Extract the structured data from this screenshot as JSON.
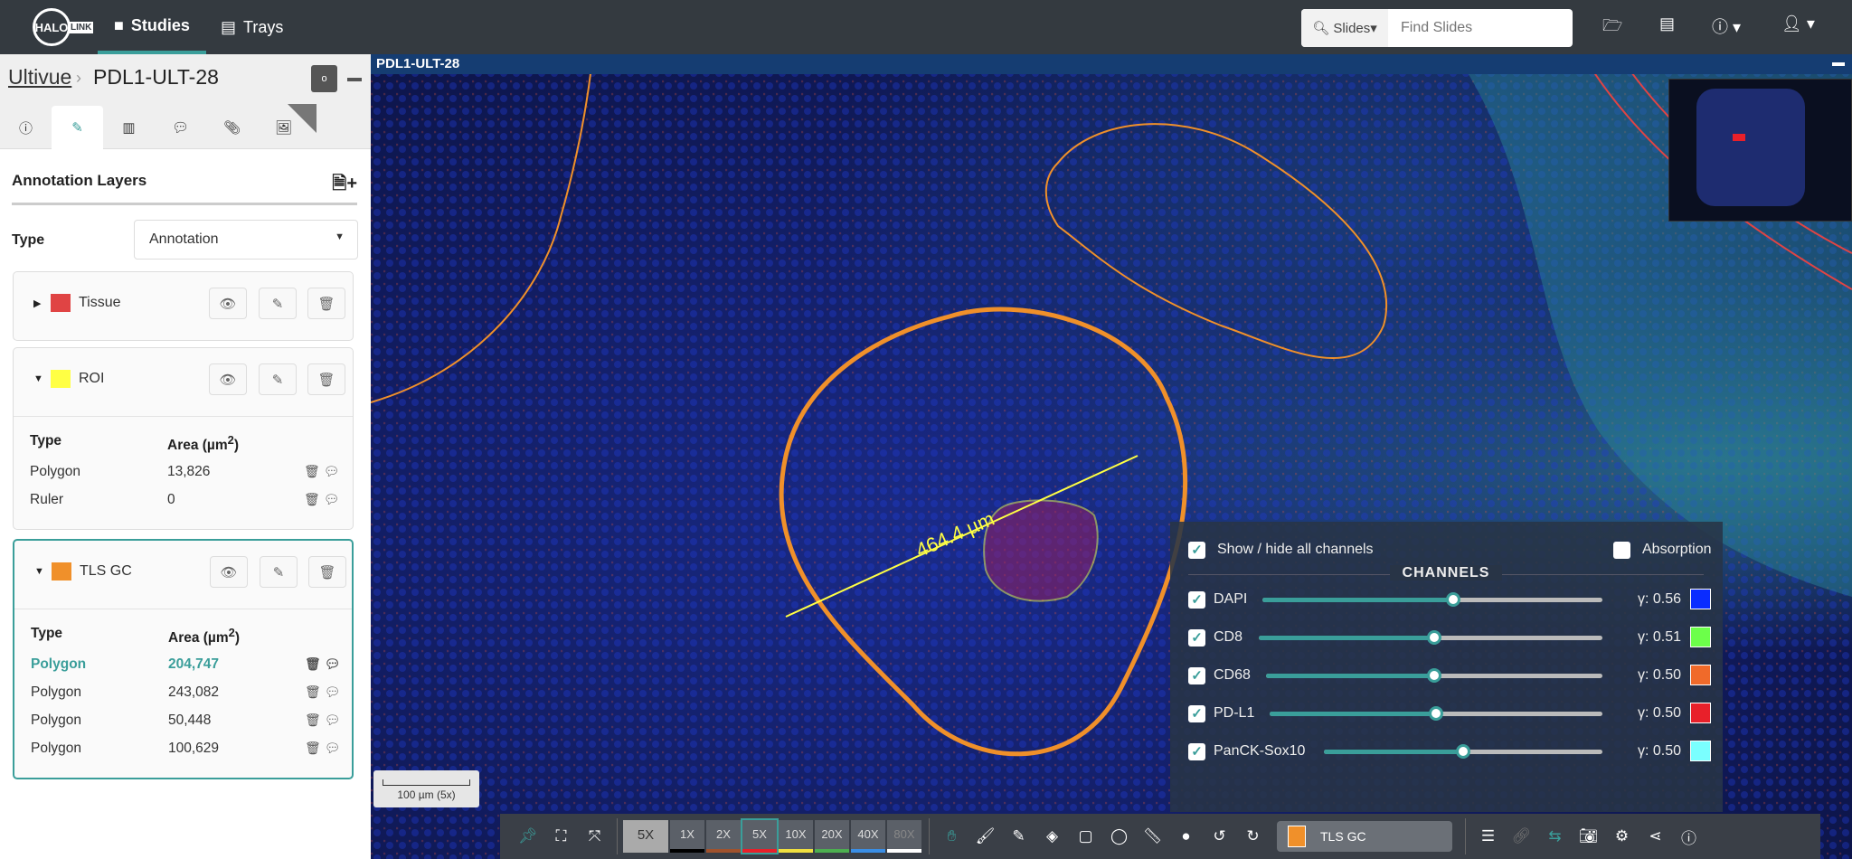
{
  "header": {
    "logo": "HALO LINK",
    "nav": [
      {
        "label": "Studies",
        "icon": "folder-icon",
        "active": true
      },
      {
        "label": "Trays",
        "icon": "list-icon"
      }
    ],
    "search": {
      "scope": "Slides",
      "placeholder": "Find Slides"
    },
    "icons": [
      "folder-open-icon",
      "list-icon",
      "help-icon",
      "user-icon"
    ]
  },
  "sidebar": {
    "breadcrumb": {
      "parent": "Ultivue",
      "current": "PDL1-ULT-28"
    },
    "o_button": "o",
    "tabs": [
      "info-icon",
      "pencil-icon",
      "chart-icon",
      "comments-icon",
      "paperclip-icon",
      "images-icon"
    ],
    "active_tab": 1,
    "section_title": "Annotation Layers",
    "type_label": "Type",
    "type_value": "Annotation",
    "layers": [
      {
        "name": "Tissue",
        "color": "#e04444",
        "expanded": false
      },
      {
        "name": "ROI",
        "color": "#ffff44",
        "expanded": true,
        "col_type": "Type",
        "col_area": "Area (µm",
        "sup": "2",
        "rows": [
          {
            "type": "Polygon",
            "area": "13,826"
          },
          {
            "type": "Ruler",
            "area": "0"
          }
        ]
      },
      {
        "name": "TLS GC",
        "color": "#f0902a",
        "expanded": true,
        "selected": true,
        "col_type": "Type",
        "col_area": "Area (µm",
        "sup": "2",
        "rows": [
          {
            "type": "Polygon",
            "area": "204,747",
            "active": true
          },
          {
            "type": "Polygon",
            "area": "243,082"
          },
          {
            "type": "Polygon",
            "area": "50,448"
          },
          {
            "type": "Polygon",
            "area": "100,629"
          }
        ]
      }
    ]
  },
  "viewer": {
    "title": "PDL1-ULT-28",
    "ruler_label": "464.4 µm",
    "scale_label": "100 µm (5x)"
  },
  "channels": {
    "show_all": "Show / hide all channels",
    "absorption": "Absorption",
    "heading": "CHANNELS",
    "items": [
      {
        "name": "DAPI",
        "gamma": "γ: 0.56",
        "level": 0.56,
        "color": "#0a2cff"
      },
      {
        "name": "CD8",
        "gamma": "γ: 0.51",
        "level": 0.51,
        "color": "#6cff4a"
      },
      {
        "name": "CD68",
        "gamma": "γ: 0.50",
        "level": 0.5,
        "color": "#f06a2a"
      },
      {
        "name": "PD-L1",
        "gamma": "γ: 0.50",
        "level": 0.5,
        "color": "#e8202a"
      },
      {
        "name": "PanCK-Sox10",
        "gamma": "γ: 0.50",
        "level": 0.5,
        "color": "#7affff"
      }
    ]
  },
  "toolbar": {
    "current_zoom": "5X",
    "zooms": [
      {
        "label": "1X",
        "color": "#000000"
      },
      {
        "label": "2X",
        "color": "#a0522d"
      },
      {
        "label": "5X",
        "color": "#e8202a",
        "active": true
      },
      {
        "label": "10X",
        "color": "#f0e040"
      },
      {
        "label": "20X",
        "color": "#4caf50"
      },
      {
        "label": "40X",
        "color": "#3a8ee6"
      },
      {
        "label": "80X",
        "color": "#ffffff",
        "disabled": true
      }
    ],
    "active_layer": "TLS GC",
    "active_layer_color": "#f0902a"
  },
  "accent": "#3a9e9a"
}
